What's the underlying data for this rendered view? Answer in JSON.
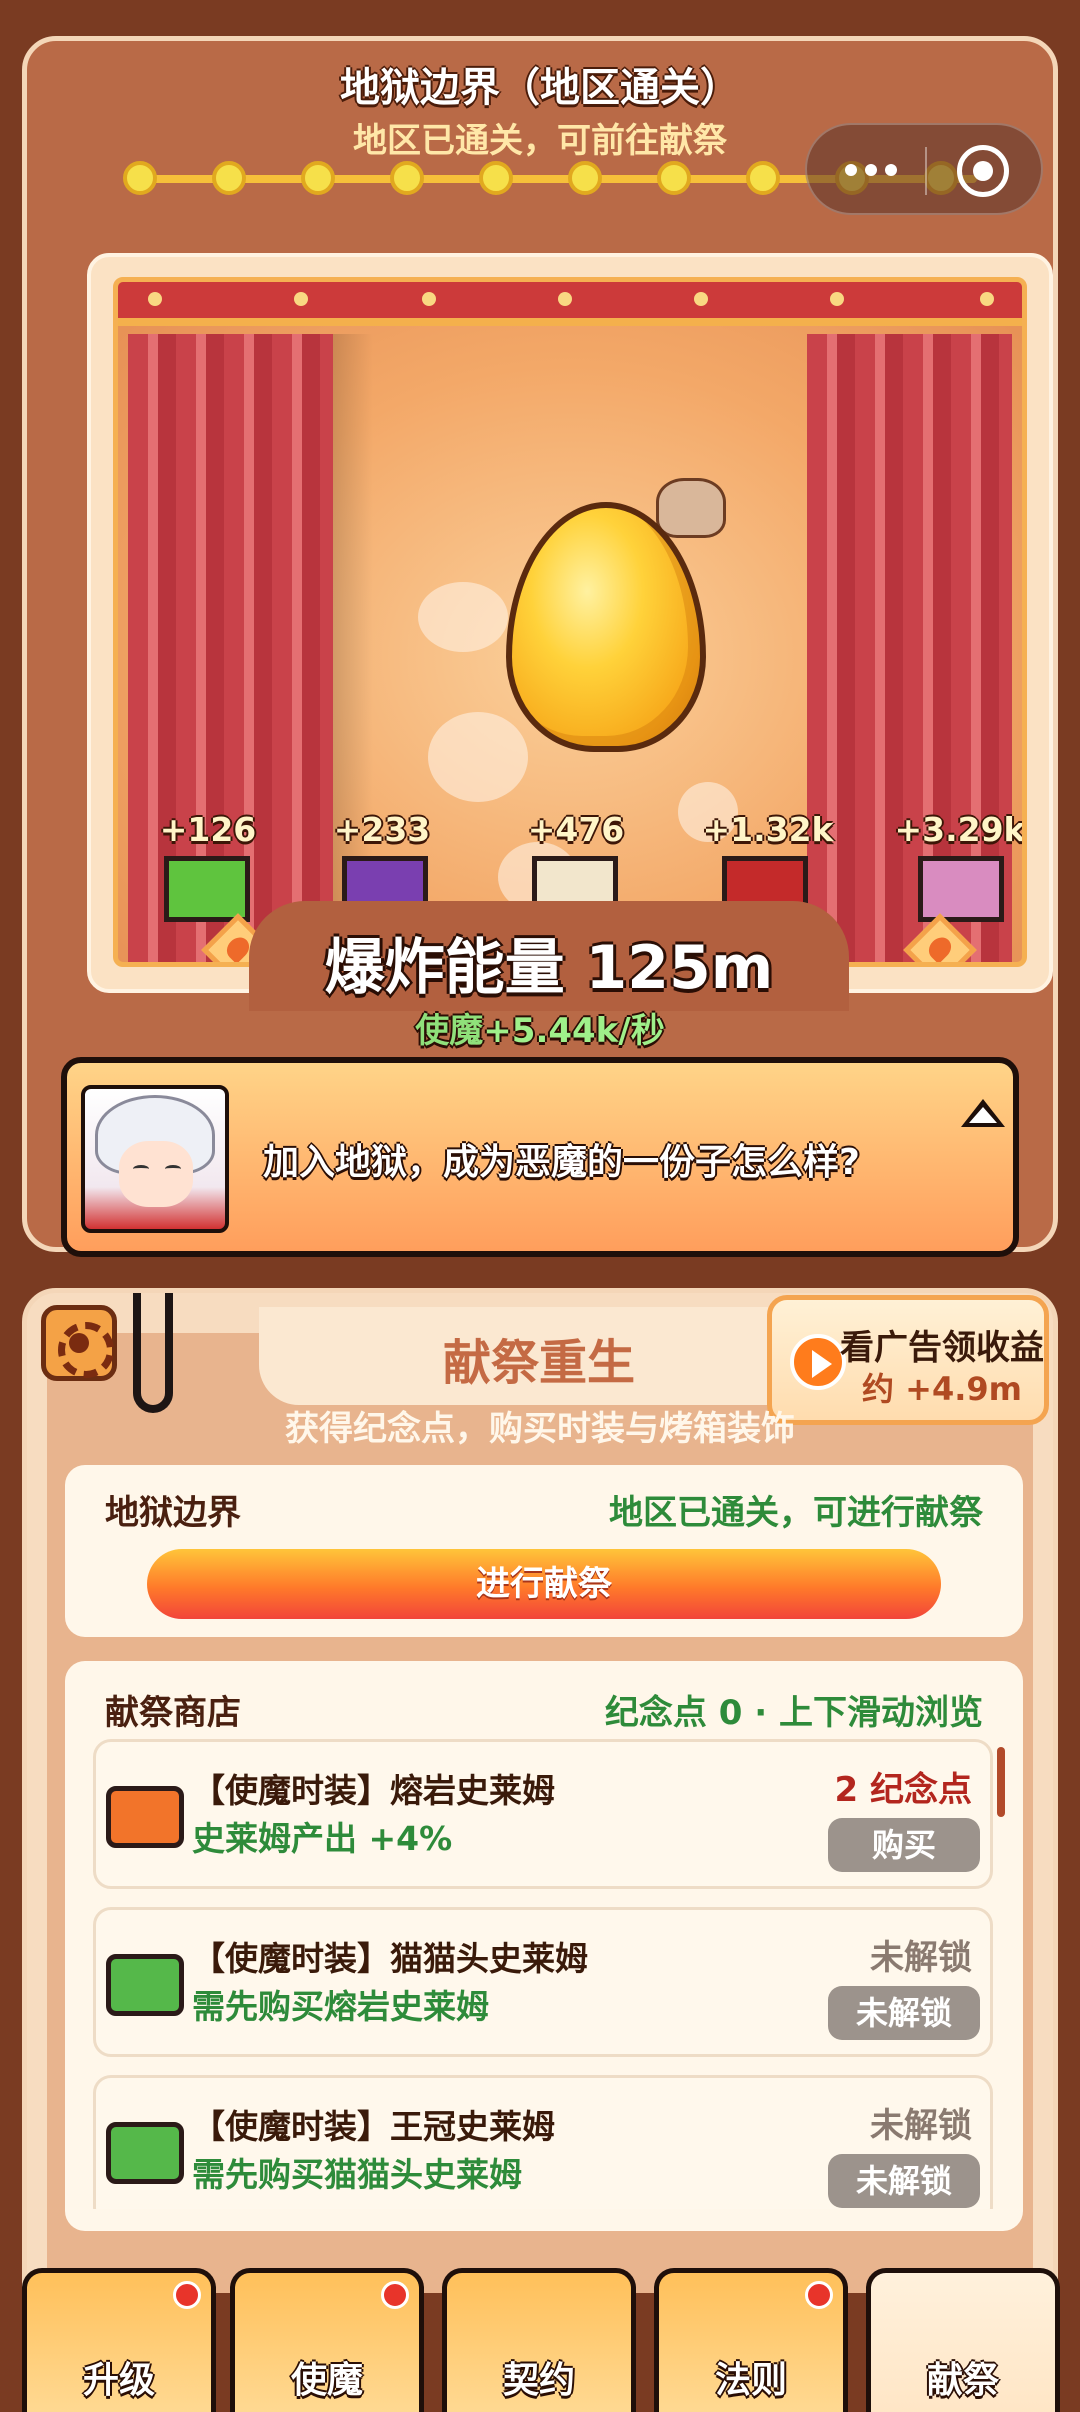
{
  "header": {
    "title": "地狱边界（地区通关）",
    "subtitle": "地区已通关，可前往献祭",
    "progress_stages": 10
  },
  "stage": {
    "monsters": [
      {
        "label": "+126",
        "color": "#5fc43e"
      },
      {
        "label": "+233",
        "color": "#7a3fb0"
      },
      {
        "label": "+476",
        "color": "#f2e6cc"
      },
      {
        "label": "+1.32k",
        "color": "#c42a2a"
      },
      {
        "label": "+3.29k",
        "color": "#d98cc0"
      }
    ],
    "energy_label": "爆炸能量 125m",
    "rate_label": "使魔",
    "rate_value": "+5.44k/秒"
  },
  "dialog": {
    "text": "加入地狱，成为恶魔的一份子怎么样?"
  },
  "sacrifice": {
    "title": "献祭重生",
    "description": "获得纪念点，购买时装与烤箱装饰",
    "ad_button": {
      "title": "看广告领收益",
      "subtitle": "约 +4.9m"
    },
    "region": "地狱边界",
    "status": "地区已通关，可进行献祭",
    "action_button": "进行献祭"
  },
  "shop": {
    "title": "献祭商店",
    "meta": "纪念点 0 · 上下滑动浏览",
    "items": [
      {
        "name": "【使魔时装】熔岩史莱姆",
        "desc": "史莱姆产出 +4%",
        "price": "2 纪念点",
        "button": "购买",
        "icon_color": "#f2742a",
        "price_color": "#b3261e"
      },
      {
        "name": "【使魔时装】猫猫头史莱姆",
        "desc": "需先购买熔岩史莱姆",
        "price": "未解锁",
        "button": "未解锁",
        "icon_color": "#55b84a",
        "price_color": "#8a7a70"
      },
      {
        "name": "【使魔时装】王冠史莱姆",
        "desc": "需先购买猫猫头史莱姆",
        "price": "未解锁",
        "button": "未解锁",
        "icon_color": "#55b84a",
        "price_color": "#8a7a70"
      }
    ]
  },
  "nav": [
    {
      "label": "升级",
      "badge": true,
      "active": false
    },
    {
      "label": "使魔",
      "badge": true,
      "active": false
    },
    {
      "label": "契约",
      "badge": false,
      "active": false
    },
    {
      "label": "法则",
      "badge": true,
      "active": false
    },
    {
      "label": "献祭",
      "badge": false,
      "active": true
    }
  ]
}
